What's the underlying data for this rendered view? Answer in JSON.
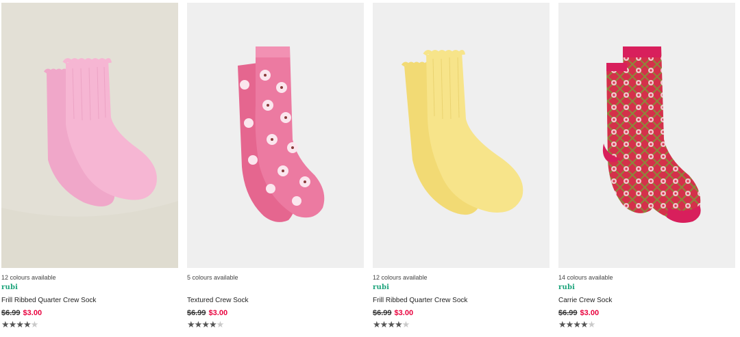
{
  "products": [
    {
      "colours": "12 colours available",
      "brand": "rubi",
      "name": "Frill Ribbed Quarter Crew Sock",
      "was_price": "$6.99",
      "now_price": "$3.00",
      "rating": 4.5,
      "image_icon": "pink-frill-sock-image"
    },
    {
      "colours": "5 colours available",
      "brand": "",
      "name": "Textured Crew Sock",
      "was_price": "$6.99",
      "now_price": "$3.00",
      "rating": 4,
      "image_icon": "pink-floral-sock-image"
    },
    {
      "colours": "12 colours available",
      "brand": "rubi",
      "name": "Frill Ribbed Quarter Crew Sock",
      "was_price": "$6.99",
      "now_price": "$3.00",
      "rating": 4.5,
      "image_icon": "yellow-frill-sock-image"
    },
    {
      "colours": "14 colours available",
      "brand": "rubi",
      "name": "Carrie Crew Sock",
      "was_price": "$6.99",
      "now_price": "$3.00",
      "rating": 4.5,
      "image_icon": "red-geometric-sock-image"
    }
  ],
  "colors": {
    "sale_price": "#e8003d",
    "brand": "#1aa37a"
  }
}
